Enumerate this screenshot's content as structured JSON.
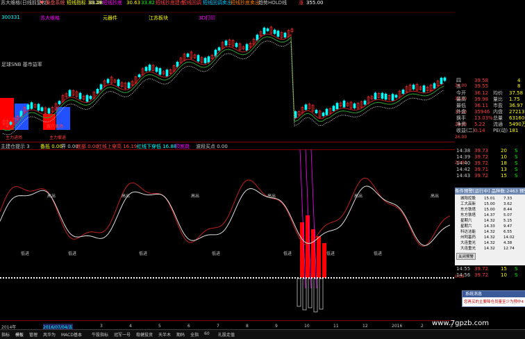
{
  "title_bar": {
    "items": [
      {
        "text": "苏大维格(日线前复权)",
        "color": "#c8c8c8"
      },
      {
        "text": "♥ 操盘系统",
        "color": "#ff6060"
      },
      {
        "text": "短线指标 33.28",
        "color": "#ffff00"
      },
      {
        "text": "33.28",
        "color": "#ffffff"
      },
      {
        "text": "短线抄底",
        "color": "#ff00ff"
      },
      {
        "text": "30.63",
        "color": "#ffff00"
      },
      {
        "text": "33.82",
        "color": "#00ff00"
      },
      {
        "text": "短线抄底建仓",
        "color": "#ff4040"
      },
      {
        "text": "短线回调",
        "color": "#ff4040"
      },
      {
        "text": "短线回调卖出",
        "color": "#00c8ff"
      },
      {
        "text": "短线抄底卖出",
        "color": "#ff8000"
      },
      {
        "text": "趋势HOLD线",
        "color": "#c8c8c8"
      },
      {
        "text": "涨",
        "color": "#ff4040"
      },
      {
        "text": "355.00",
        "color": "#ffffff"
      }
    ]
  },
  "main_chart": {
    "labels": [
      {
        "text": "300331",
        "color": "#00ffff"
      },
      {
        "text": "苏大维格",
        "color": "#ff00ff"
      },
      {
        "text": "元器件",
        "color": "#ffff00"
      },
      {
        "text": "江苏板块",
        "color": "#ffff00"
      },
      {
        "text": "3D打印",
        "color": "#ff00ff"
      },
      {
        "text": "足球SNB 基市益率",
        "color": "#c8c8c8"
      },
      {
        "text": "主力进场",
        "color": "#ff4040"
      },
      {
        "text": "散户离场",
        "color": "#ff4040"
      },
      {
        "text": "主力撤退",
        "color": "#ff4040"
      }
    ],
    "price_axis": [
      "34.00",
      "32.00",
      "30.00",
      "28.00",
      "26.00"
    ],
    "candle_colors": {
      "up": "#ff3030",
      "down": "#00ffff"
    }
  },
  "indicator": {
    "header": [
      {
        "text": "主建仓提示 3",
        "color": "#c8c8c8"
      },
      {
        "text": "备抵 0.00",
        "color": "#ffff00"
      },
      {
        "text": "界 0.00",
        "color": "#c8c8c8"
      },
      {
        "text": "底部 0.00",
        "color": "#ff4040"
      },
      {
        "text": "红线上穿高 16.19",
        "color": "#ff4040"
      },
      {
        "text": "红线下穿低 16.88",
        "color": "#00ffff"
      },
      {
        "text": "顶底跳",
        "color": "#ff00ff"
      },
      {
        "text": "波段买点 0.00",
        "color": "#c8c8c8"
      }
    ],
    "axis": [
      "20.00",
      "0.00"
    ],
    "signal_labels_top": [
      "高出",
      "高出",
      "高出",
      "高出",
      "高出",
      "高出"
    ],
    "signal_labels_bottom": [
      "低进",
      "低进",
      "低进",
      "低进",
      "低进",
      "低进",
      "低进"
    ]
  },
  "quote_panel": {
    "rows": [
      {
        "left": "四",
        "right": "39.58",
        "right2": "4",
        "color": "#ff4040"
      },
      {
        "left": "五",
        "right": "39.55",
        "right2": "8",
        "color": "#ff4040"
      },
      {
        "left": "今开",
        "right": "36.12",
        "mid": "均价",
        "right2": "37.58"
      },
      {
        "left": "最高",
        "right": "39.98",
        "mid": "量比",
        "right2": "1.75"
      },
      {
        "left": "最低",
        "right": "36.11",
        "mid": "市盈",
        "right2": "36.97"
      },
      {
        "left": "外盘",
        "right": "35946",
        "mid": "内盘",
        "right2": "27213"
      },
      {
        "left": "换手",
        "right": "13.03%",
        "mid": "总量",
        "right2": "63160"
      },
      {
        "left": "净资",
        "right": "5.22",
        "mid": "流通",
        "right2": "5490万"
      },
      {
        "left": "收益(二)",
        "right": "0.14",
        "mid": "PE(动)",
        "right2": "181"
      }
    ],
    "ticks": [
      {
        "time": "14:38",
        "price": "39.73",
        "vol": "20",
        "flag": "S"
      },
      {
        "time": "14:39",
        "price": "39.72",
        "vol": "10",
        "flag": "S"
      },
      {
        "time": "14:40",
        "price": "39.72",
        "vol": "18",
        "flag": "S"
      },
      {
        "time": "14:42",
        "price": "39.71",
        "vol": "13",
        "flag": "S"
      },
      {
        "time": "14:43",
        "price": "39.72",
        "vol": "15",
        "flag": "S"
      }
    ]
  },
  "condition_panel": {
    "title": "条件预警[运行中] 品种数:2463 预警",
    "rows": [
      {
        "name": "城阳控股",
        "v1": "15.01",
        "v2": "7.33"
      },
      {
        "name": "工大高新",
        "v1": "15.00",
        "v2": "3.62"
      },
      {
        "name": "东方铁塔",
        "v1": "15.00",
        "v2": "8.44"
      },
      {
        "name": "东方铁塔",
        "v1": "14.37",
        "v2": "5.07"
      },
      {
        "name": "星期六",
        "v1": "14.32",
        "v2": "5.15"
      },
      {
        "name": "星期六",
        "v1": "14.33",
        "v2": "9.47"
      },
      {
        "name": "科达洁能",
        "v1": "14.32",
        "v2": "6.55"
      },
      {
        "name": "州阿基药",
        "v1": "14.32",
        "v2": "14.02"
      },
      {
        "name": "大连重光",
        "v1": "14.32",
        "v2": "4.38"
      },
      {
        "name": "大连重光",
        "v1": "14.32",
        "v2": "12.74"
      }
    ],
    "close_label": "关闭预警",
    "extra_ticks": [
      {
        "time": "14:55",
        "price": "39.72",
        "vol": "15",
        "flag": "S"
      },
      {
        "time": "14:56",
        "price": "39.72",
        "vol": "10",
        "flag": "S"
      }
    ]
  },
  "system_popup": {
    "title": "系统消息",
    "body": "您再买的主要降仓员量至少为预中4"
  },
  "bottom_axis": [
    "2014年",
    "2016/07/04/五",
    "3",
    "4",
    "5",
    "6",
    "7",
    "8",
    "9",
    "10",
    "11",
    "12",
    "2016",
    "2",
    "3"
  ],
  "tabs": [
    "指标",
    "模板",
    "管理",
    "风华为",
    "MACD基本",
    "牛股指标",
    "冠军一号",
    "稳健投资",
    "天半木",
    "期码",
    "全指",
    "60",
    "礼股走值"
  ],
  "watermark": "www.7gpzb.com"
}
